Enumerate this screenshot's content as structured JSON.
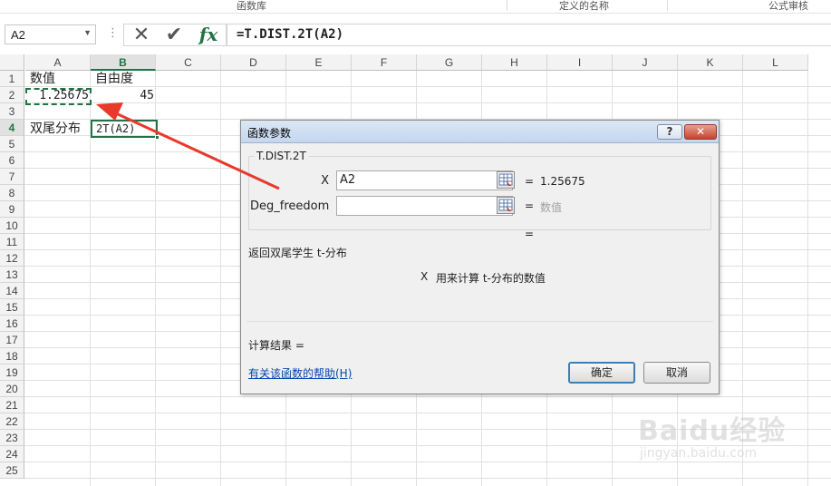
{
  "ribbon": {
    "groups": [
      "函数库",
      "定义的名称",
      "公式审核"
    ]
  },
  "formula_bar": {
    "name_box": "A2",
    "dropdown_glyph": "▼",
    "dots": "⋮",
    "cancel_icon": "✕",
    "enter_icon": "✔",
    "fx_label": "fx",
    "formula": "=T.DIST.2T(A2)"
  },
  "sheet": {
    "columns": [
      "A",
      "B",
      "C",
      "D",
      "E",
      "F",
      "G",
      "H",
      "I",
      "J",
      "K",
      "L"
    ],
    "selected_column": "B",
    "rows": [
      "1",
      "2",
      "3",
      "4",
      "5",
      "6",
      "7",
      "8",
      "9",
      "10",
      "11",
      "12",
      "13",
      "14",
      "15",
      "16",
      "17",
      "18",
      "19",
      "20",
      "21",
      "22",
      "23",
      "24",
      "25"
    ],
    "selected_row": "4",
    "cells": {
      "a1": "数值",
      "b1": "自由度",
      "a2": "1.25675",
      "b2": "45",
      "a4": "双尾分布",
      "b4": "2T(A2)"
    }
  },
  "dialog": {
    "title": "函数参数",
    "help_btn": "?",
    "close_btn": "✕",
    "function_name": "T.DIST.2T",
    "args": [
      {
        "label": "X",
        "value": "A2",
        "eq": "=",
        "result": "1.25675"
      },
      {
        "label": "Deg_freedom",
        "value": "",
        "eq": "=",
        "result": "数值"
      }
    ],
    "total_eq": "=",
    "description": "返回双尾学生 t-分布",
    "arg_desc_name": "X",
    "arg_desc_text": "用来计算 t-分布的数值",
    "result_label": "计算结果 =",
    "help_link": "有关该函数的帮助(H)",
    "ok_label": "确定",
    "cancel_label": "取消"
  },
  "watermark": {
    "brand": "Baidu经验",
    "url": "jingyan.baidu.com"
  },
  "colors": {
    "excel_green": "#217346",
    "arrow_red": "#e8392b"
  }
}
